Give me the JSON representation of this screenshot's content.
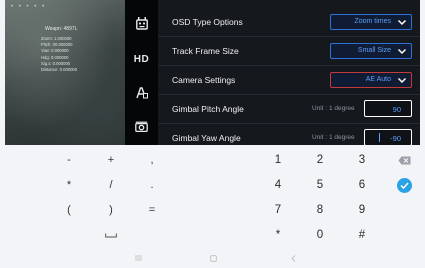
{
  "preview": {
    "dots": "• • • • •",
    "vehicle_name": "Weapn: 4897L",
    "telemetry": "Zoom: 1.000000\nPitch: 00.000000\nYaw: 0.000000\nHdg: 0.000000\nSig.x: 0.000000\nDistance: 0.000000"
  },
  "toolbar": {
    "items": [
      {
        "icon": "robot-icon"
      },
      {
        "icon": "hd-icon",
        "text": "HD"
      },
      {
        "icon": "font-settings-icon"
      },
      {
        "icon": "camera-icon"
      }
    ]
  },
  "settings": {
    "osd_type": {
      "label": "OSD Type Options",
      "value": "Zoom times"
    },
    "track_frame": {
      "label": "Track Frame Size",
      "value": "Small Size"
    },
    "camera": {
      "label": "Camera Settings",
      "value": "AE Auto"
    },
    "pitch": {
      "label": "Gimbal Pitch Angle",
      "unit": "Unit : 1 degree",
      "value": "90"
    },
    "yaw": {
      "label": "Gimbal Yaw  Angle",
      "unit": "Unit : 1 degree",
      "value": "-90"
    }
  },
  "colors": {
    "accent_blue": "#2f6fd6",
    "value_blue": "#5c9dff",
    "alert_red": "#c23a3a",
    "done_blue": "#29a3e6"
  },
  "keyboard": {
    "keys": [
      {
        "name": "key-minus",
        "label": "-"
      },
      {
        "name": "key-plus",
        "label": "+"
      },
      {
        "name": "key-comma",
        "label": ","
      },
      {
        "name": "key-1",
        "label": "1"
      },
      {
        "name": "key-2",
        "label": "2"
      },
      {
        "name": "key-3",
        "label": "3"
      },
      {
        "name": "key-multiply",
        "label": "*"
      },
      {
        "name": "key-divide",
        "label": "/"
      },
      {
        "name": "key-period",
        "label": "."
      },
      {
        "name": "key-4",
        "label": "4"
      },
      {
        "name": "key-5",
        "label": "5"
      },
      {
        "name": "key-6",
        "label": "6"
      },
      {
        "name": "key-open-paren",
        "label": "("
      },
      {
        "name": "key-close-paren",
        "label": ")"
      },
      {
        "name": "key-equals",
        "label": "="
      },
      {
        "name": "key-7",
        "label": "7"
      },
      {
        "name": "key-8",
        "label": "8"
      },
      {
        "name": "key-9",
        "label": "9"
      },
      {
        "name": "key-star",
        "label": "*"
      },
      {
        "name": "key-0",
        "label": "0"
      },
      {
        "name": "key-hash",
        "label": "#"
      }
    ],
    "icons": {
      "backspace": "backspace-icon",
      "done": "checkmark-icon",
      "space": "space-icon"
    }
  },
  "navbar": {
    "icons": [
      "menu-icon",
      "home-icon",
      "back-icon"
    ]
  }
}
